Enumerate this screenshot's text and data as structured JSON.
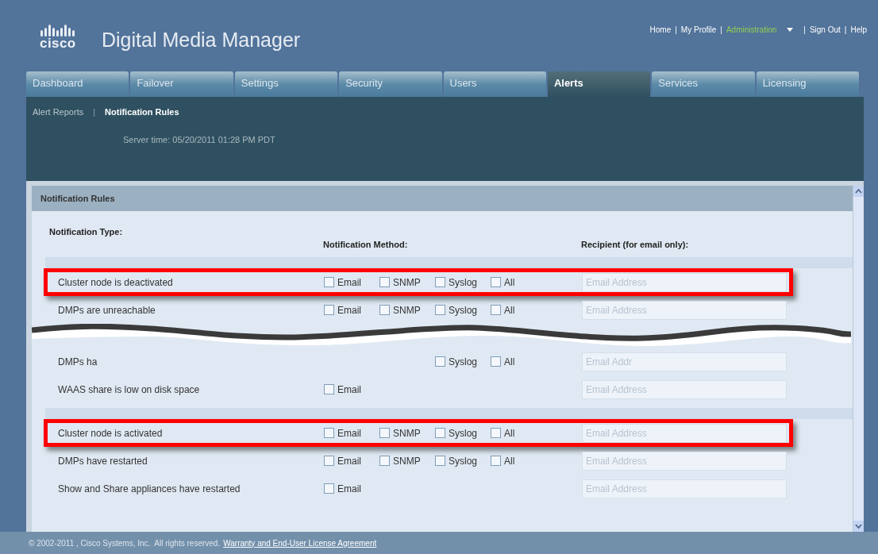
{
  "brand": {
    "logo": "cisco",
    "title": "Digital Media Manager"
  },
  "nav": {
    "separator": "|",
    "links": [
      {
        "label": "Home",
        "selected": false,
        "dropdown": false
      },
      {
        "label": "My Profile",
        "selected": false,
        "dropdown": false
      },
      {
        "label": "Administration",
        "selected": true,
        "dropdown": true
      },
      {
        "label": "Sign Out",
        "selected": false,
        "dropdown": false
      },
      {
        "label": "Help",
        "selected": false,
        "dropdown": false
      }
    ]
  },
  "tabs": [
    {
      "label": "Dashboard",
      "selected": false
    },
    {
      "label": "Failover",
      "selected": false
    },
    {
      "label": "Settings",
      "selected": false
    },
    {
      "label": "Security",
      "selected": false
    },
    {
      "label": "Users",
      "selected": false
    },
    {
      "label": "Alerts",
      "selected": true
    },
    {
      "label": "Services",
      "selected": false
    },
    {
      "label": "Licensing",
      "selected": false
    }
  ],
  "subnav": {
    "separator": "|",
    "links": [
      {
        "label": "Alert Reports",
        "selected": false
      },
      {
        "label": "Notification Rules",
        "selected": true
      }
    ]
  },
  "server_time": "Server time: 05/20/2011 01:28 PM PDT",
  "panel": {
    "title": "Notification Rules",
    "columns": [
      "Notification Type:",
      "Notification Method:",
      "Recipient (for email only):"
    ],
    "sections": [
      {
        "rows": [
          {
            "label": "Cluster node is deactivated",
            "highlighted": true,
            "methods": [
              {
                "kind": "checkbox",
                "label": "Email",
                "checked": false
              },
              {
                "kind": "checkbox",
                "label": "SNMP",
                "checked": false
              },
              {
                "kind": "checkbox",
                "label": "Syslog",
                "checked": false
              },
              {
                "kind": "checkbox",
                "label": "All",
                "checked": false
              }
            ],
            "placeholder": "Email Address"
          },
          {
            "label": "DMPs are unreachable",
            "highlighted": false,
            "methods": [
              {
                "kind": "checkbox",
                "label": "Email",
                "checked": false
              },
              {
                "kind": "checkbox",
                "label": "SNMP",
                "checked": false
              },
              {
                "kind": "checkbox",
                "label": "Syslog",
                "checked": false
              },
              {
                "kind": "checkbox",
                "label": "All",
                "checked": false
              }
            ],
            "placeholder": "Email Address"
          },
          {
            "kind": "break"
          },
          {
            "label": "DMPs ha",
            "highlighted": false,
            "methods": [
              {
                "kind": "covered"
              },
              {
                "kind": "covered"
              },
              {
                "kind": "checkbox",
                "label": "Syslog",
                "checked": false
              },
              {
                "kind": "checkbox",
                "label": "All",
                "checked": false
              }
            ],
            "placeholder": "Email Addr"
          },
          {
            "label": "WAAS share is low on disk space",
            "highlighted": false,
            "methods": [
              {
                "kind": "checkbox",
                "label": "Email",
                "checked": false
              }
            ],
            "placeholder": "Email Address"
          }
        ]
      },
      {
        "rows": [
          {
            "label": "Cluster node is activated",
            "highlighted": true,
            "methods": [
              {
                "kind": "checkbox",
                "label": "Email",
                "checked": false
              },
              {
                "kind": "checkbox",
                "label": "SNMP",
                "checked": false
              },
              {
                "kind": "checkbox",
                "label": "Syslog",
                "checked": false
              },
              {
                "kind": "checkbox",
                "label": "All",
                "checked": false
              }
            ],
            "placeholder": "Email Address"
          },
          {
            "label": "DMPs have restarted",
            "highlighted": false,
            "methods": [
              {
                "kind": "checkbox",
                "label": "Email",
                "checked": false
              },
              {
                "kind": "checkbox",
                "label": "SNMP",
                "checked": false
              },
              {
                "kind": "checkbox",
                "label": "Syslog",
                "checked": false
              },
              {
                "kind": "checkbox",
                "label": "All",
                "checked": false
              }
            ],
            "placeholder": "Email Address"
          },
          {
            "label": "Show and Share appliances have restarted",
            "highlighted": false,
            "methods": [
              {
                "kind": "checkbox",
                "label": "Email",
                "checked": false
              }
            ],
            "placeholder": "Email Address"
          }
        ]
      }
    ]
  },
  "footer": {
    "copyright": "© 2002-2011 , Cisco Systems, Inc.  All rights reserved.",
    "link": "Warranty and End-User License Agreement"
  }
}
